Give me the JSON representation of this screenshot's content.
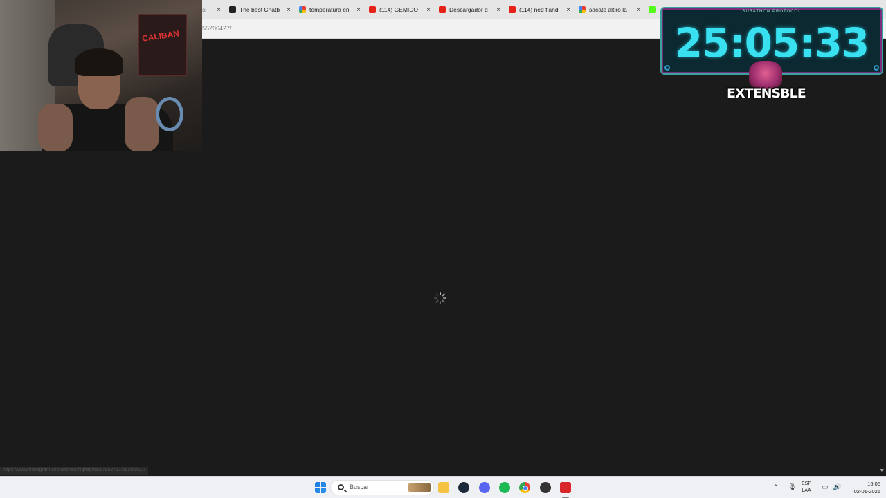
{
  "browser": {
    "tabs": [
      {
        "label": "si",
        "favicon": "page-icon"
      },
      {
        "label": "The best Chatb",
        "favicon": "github-icon"
      },
      {
        "label": "temperatura en",
        "favicon": "google-icon"
      },
      {
        "label": "(114) GEMIDO",
        "favicon": "youtube-icon"
      },
      {
        "label": "Descargador d",
        "favicon": "downloader-icon"
      },
      {
        "label": "(114) ned fland",
        "favicon": "youtube-icon"
      },
      {
        "label": "sacate altiro la",
        "favicon": "google-icon"
      },
      {
        "label": "",
        "favicon": "kick-icon"
      }
    ],
    "close_glyph": "×",
    "url": "55206427/",
    "status_link": "https://www.instagram.com/stories/highlights/17952757/55206427/"
  },
  "overlay": {
    "timer_label": "SUBATHON PROTOCOL",
    "timer_value": "25:05:33",
    "badge_text": "EXTENSBLE"
  },
  "webcam": {
    "poster_text": "CALIBAN"
  },
  "taskbar": {
    "search_placeholder": "Buscar",
    "lang_line1": "ESP",
    "lang_line2": "LAA",
    "time": "16:05",
    "date": "02-01-2026",
    "pinned_icons": [
      "start-icon",
      "search-icon",
      "file-explorer-icon",
      "steam-icon",
      "discord-icon",
      "spotify-icon",
      "chrome-icon",
      "obs-icon",
      "app-icon"
    ]
  }
}
